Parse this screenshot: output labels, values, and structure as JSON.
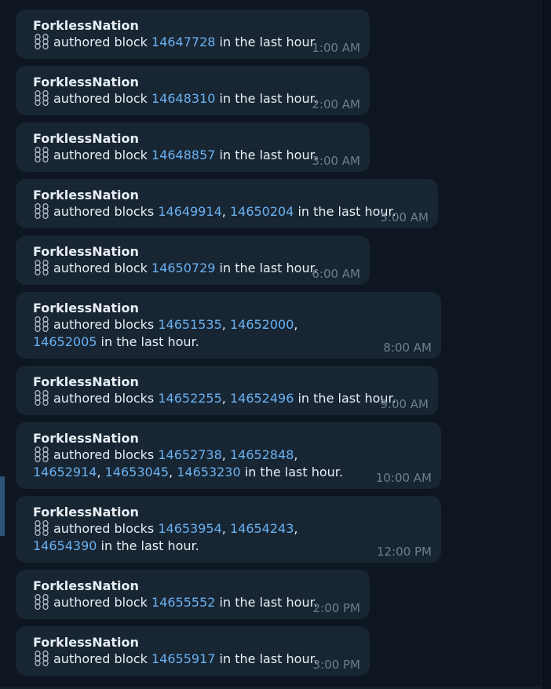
{
  "chat": {
    "messages": [
      {
        "sender": "ForklessNation",
        "verb": "authored block",
        "blocks": [
          "14647728"
        ],
        "suffix": "in the last hour.",
        "time": "1:00 AM"
      },
      {
        "sender": "ForklessNation",
        "verb": "authored block",
        "blocks": [
          "14648310"
        ],
        "suffix": "in the last hour.",
        "time": "2:00 AM"
      },
      {
        "sender": "ForklessNation",
        "verb": "authored block",
        "blocks": [
          "14648857"
        ],
        "suffix": "in the last hour.",
        "time": "3:00 AM"
      },
      {
        "sender": "ForklessNation",
        "verb": "authored blocks",
        "blocks": [
          "14649914",
          "14650204"
        ],
        "suffix": "in the last hour.",
        "time": "5:00 AM"
      },
      {
        "sender": "ForklessNation",
        "verb": "authored block",
        "blocks": [
          "14650729"
        ],
        "suffix": "in the last hour.",
        "time": "6:00 AM"
      },
      {
        "sender": "ForklessNation",
        "verb": "authored blocks",
        "blocks": [
          "14651535",
          "14652000",
          "14652005"
        ],
        "suffix": "in the last hour.",
        "time": "8:00 AM"
      },
      {
        "sender": "ForklessNation",
        "verb": "authored blocks",
        "blocks": [
          "14652255",
          "14652496"
        ],
        "suffix": "in the last hour.",
        "time": "9:00 AM"
      },
      {
        "sender": "ForklessNation",
        "verb": "authored blocks",
        "blocks": [
          "14652738",
          "14652848",
          "14652914",
          "14653045",
          "14653230"
        ],
        "suffix": "in the last hour.",
        "time": "10:00 AM"
      },
      {
        "sender": "ForklessNation",
        "verb": "authored blocks",
        "blocks": [
          "14653954",
          "14654243",
          "14654390"
        ],
        "suffix": "in the last hour.",
        "time": "12:00 PM"
      },
      {
        "sender": "ForklessNation",
        "verb": "authored block",
        "blocks": [
          "14655552"
        ],
        "suffix": "in the last hour.",
        "time": "2:00 PM"
      },
      {
        "sender": "ForklessNation",
        "verb": "authored block",
        "blocks": [
          "14655917"
        ],
        "suffix": "in the last hour.",
        "time": "3:00 PM"
      }
    ],
    "icon": "chain-link-icon",
    "colors": {
      "background": "#0e1621",
      "bubble": "#182533",
      "text": "#e8eef4",
      "link": "#6ab2f2",
      "time": "#6d7f8f",
      "scroll_indicator": "#2b5278"
    }
  }
}
